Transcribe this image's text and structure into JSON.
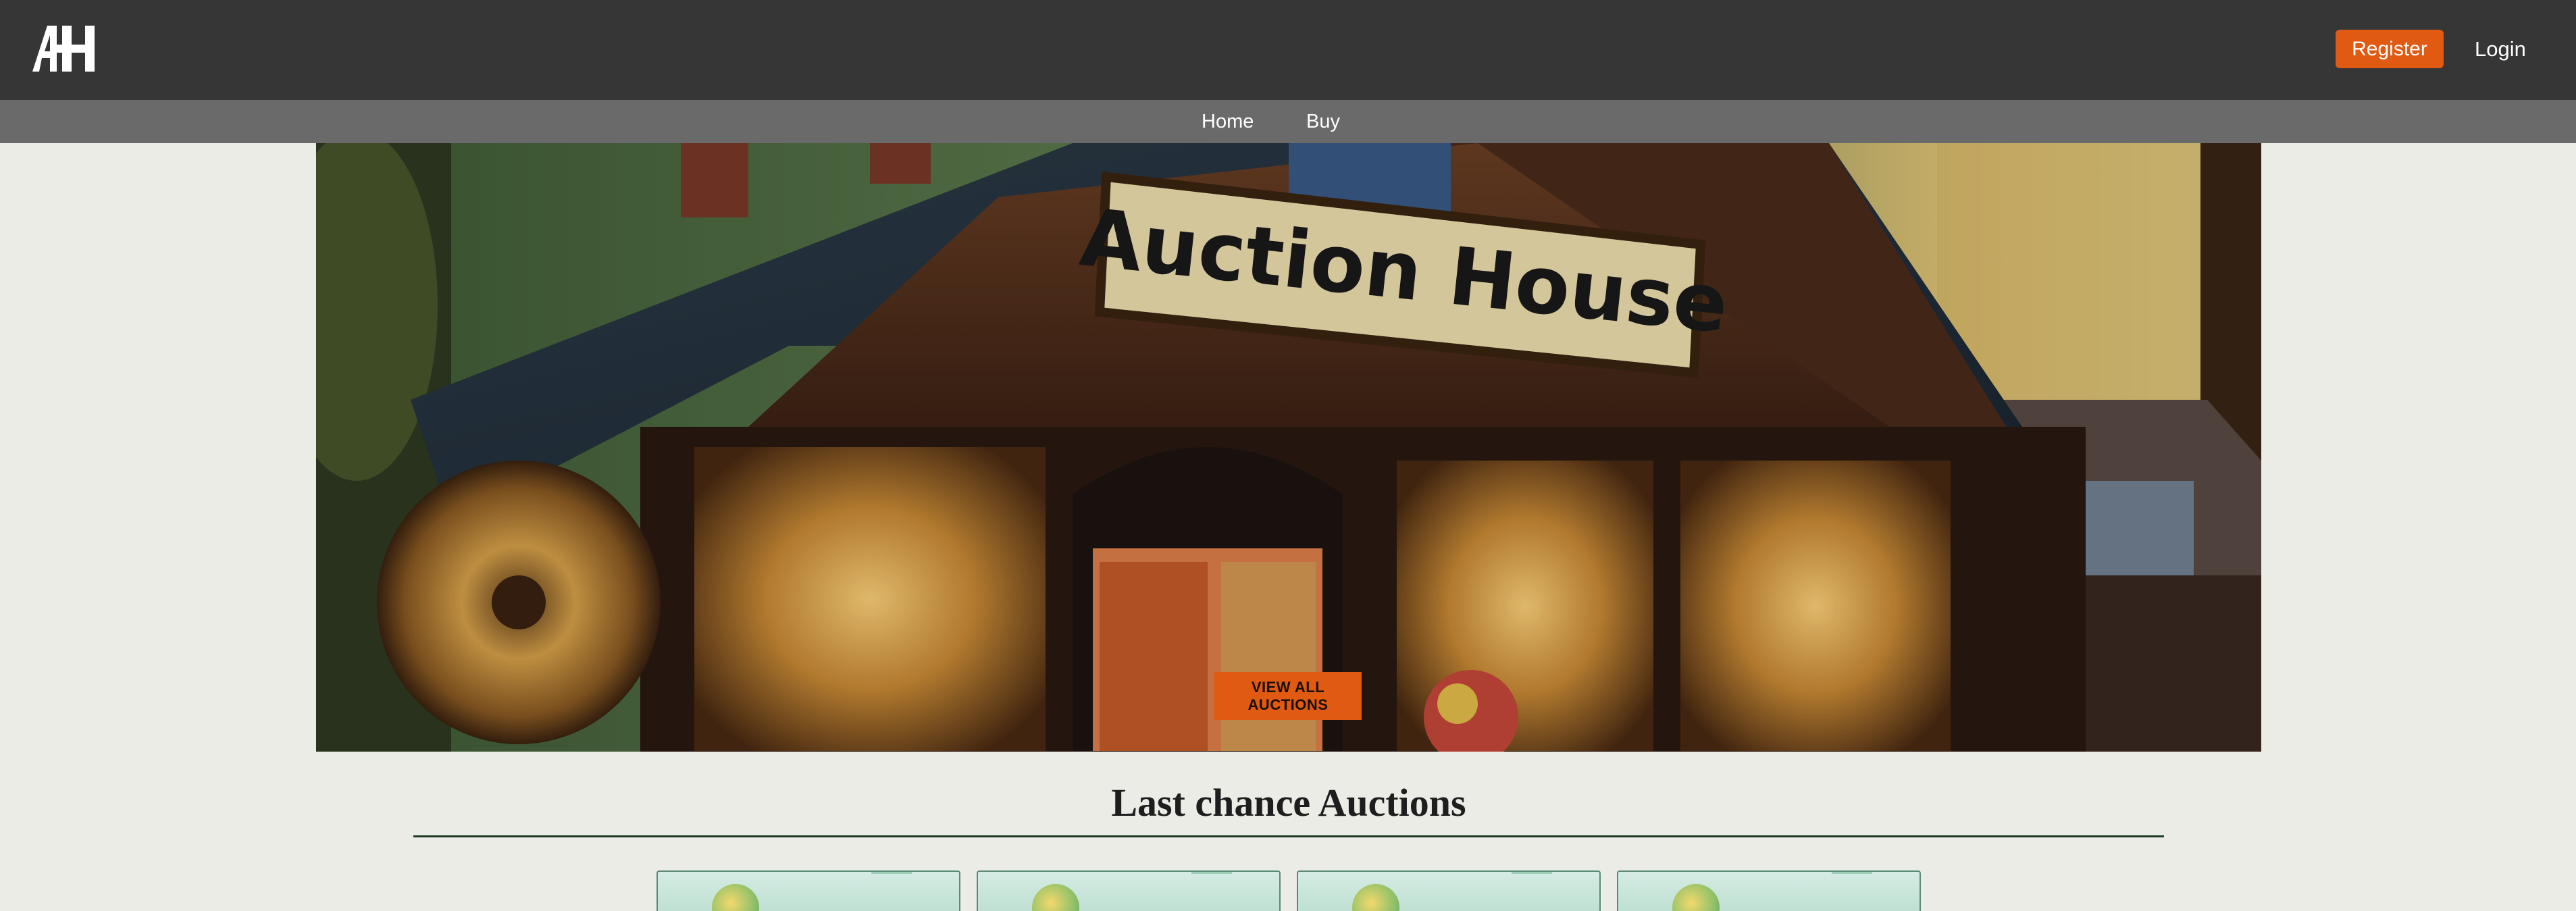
{
  "header": {
    "logo_text": "AH",
    "register_label": "Register",
    "login_label": "Login"
  },
  "nav": {
    "items": [
      {
        "label": "Home"
      },
      {
        "label": "Buy"
      }
    ]
  },
  "hero": {
    "sign_text": "Auction House",
    "cta_label": "VIEW ALL AUCTIONS"
  },
  "section": {
    "title": "Last chance Auctions"
  },
  "colors": {
    "header_bg": "#363636",
    "nav_bg": "#6a6a6a",
    "accent": "#e05a12",
    "page_bg": "#ecece6",
    "rule": "#1d3a24"
  },
  "icons": {
    "logo": "ah-logo-icon"
  }
}
